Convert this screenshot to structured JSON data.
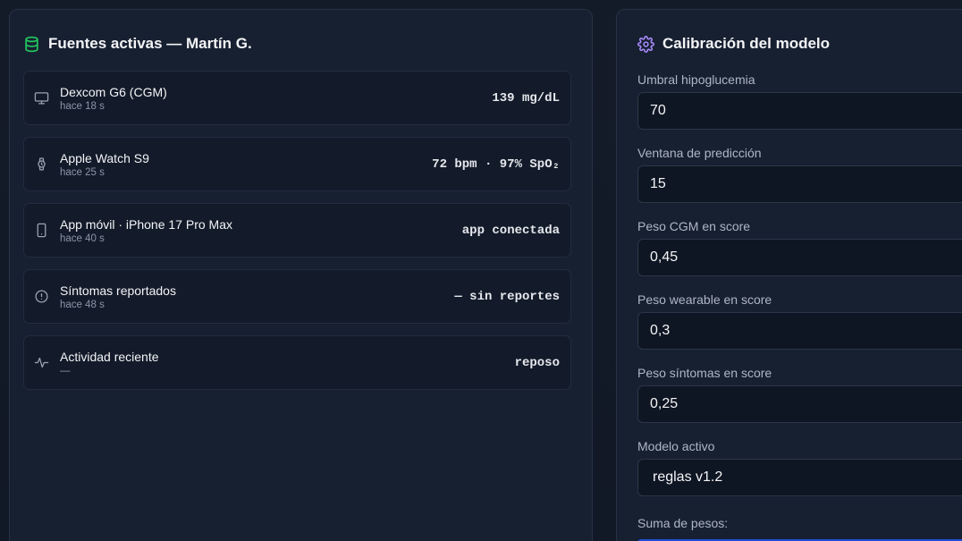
{
  "sources_panel": {
    "title": "Fuentes activas — Martín G.",
    "items": [
      {
        "name": "Dexcom G6 (CGM)",
        "sub": "hace 18 s",
        "value": "139 mg/dL",
        "icon": "monitor-icon"
      },
      {
        "name": "Apple Watch S9",
        "sub": "hace 25 s",
        "value": "72 bpm · 97% SpO₂",
        "icon": "watch-icon"
      },
      {
        "name": "App móvil · iPhone 17 Pro Max",
        "sub": "hace 40 s",
        "value": "app conectada",
        "icon": "smartphone-icon"
      },
      {
        "name": "Síntomas reportados",
        "sub": "hace 48 s",
        "value": "— sin reportes",
        "icon": "alert-circle-icon"
      },
      {
        "name": "Actividad reciente",
        "sub": "—",
        "value": "reposo",
        "icon": "activity-icon"
      }
    ]
  },
  "calibration_panel": {
    "title": "Calibración del modelo",
    "fields": [
      {
        "label": "Umbral hipoglucemia",
        "value": "70"
      },
      {
        "label": "Ventana de predicción",
        "value": "15"
      },
      {
        "label": "Peso CGM en score",
        "value": "0,45"
      },
      {
        "label": "Peso wearable en score",
        "value": "0,3"
      },
      {
        "label": "Peso síntomas en score",
        "value": "0,25"
      }
    ],
    "model": {
      "label": "Modelo activo",
      "value": "reglas v1.2"
    },
    "sum_label": "Suma de pesos:"
  },
  "colors": {
    "db_icon": "#22c55e",
    "gear_icon": "#a78bfa",
    "accent": "#1d4ed8"
  }
}
